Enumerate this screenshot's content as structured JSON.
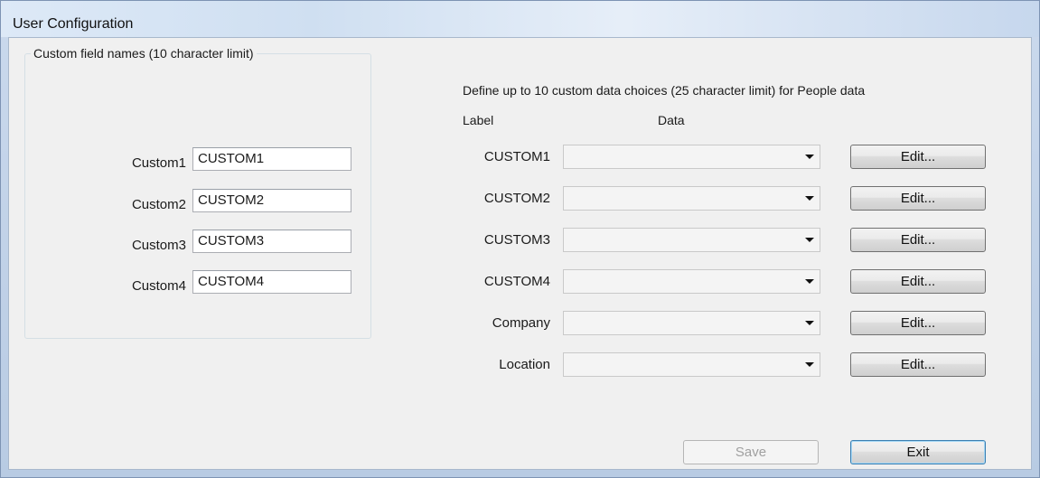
{
  "window": {
    "title": "User Configuration"
  },
  "left_group": {
    "legend": "Custom field names (10 character limit)",
    "fields": [
      {
        "label": "Custom1",
        "value": "CUSTOM1"
      },
      {
        "label": "Custom2",
        "value": "CUSTOM2"
      },
      {
        "label": "Custom3",
        "value": "CUSTOM3"
      },
      {
        "label": "Custom4",
        "value": "CUSTOM4"
      }
    ]
  },
  "right_panel": {
    "instruction": "Define up to 10 custom data choices (25 character limit) for People data",
    "col_label": "Label",
    "col_data": "Data",
    "rows": [
      {
        "label": "CUSTOM1",
        "selected": "",
        "edit_label": "Edit..."
      },
      {
        "label": "CUSTOM2",
        "selected": "",
        "edit_label": "Edit..."
      },
      {
        "label": "CUSTOM3",
        "selected": "",
        "edit_label": "Edit..."
      },
      {
        "label": "CUSTOM4",
        "selected": "",
        "edit_label": "Edit..."
      },
      {
        "label": "Company",
        "selected": "",
        "edit_label": "Edit..."
      },
      {
        "label": "Location",
        "selected": "",
        "edit_label": "Edit..."
      }
    ]
  },
  "footer": {
    "save_label": "Save",
    "save_enabled": false,
    "exit_label": "Exit"
  }
}
